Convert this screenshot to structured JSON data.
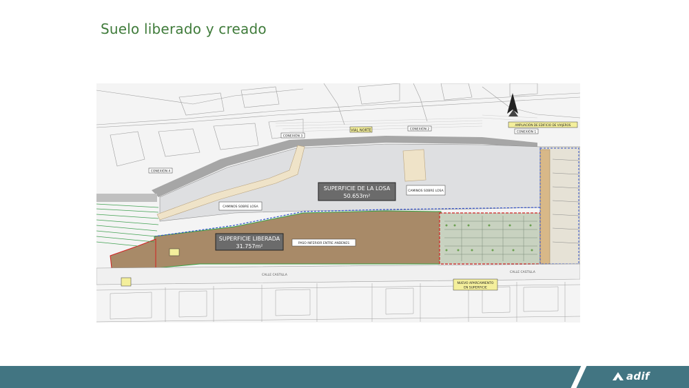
{
  "slide": {
    "title": "Suelo liberado y creado"
  },
  "plan": {
    "labels": {
      "superficie_losa": "SUPERFICIE DE LA LOSA",
      "superficie_losa_value": "50.653m²",
      "superficie_liberada": "SUPERFICIE LIBERADA",
      "superficie_liberada_value": "31.757m²",
      "vial_norte": "VIAL NORTE",
      "conexion_1": "CONEXIÓN 1",
      "conexion_2": "CONEXIÓN 2",
      "conexion_3": "CONEXIÓN 3",
      "conexion_4": "CONEXIÓN 4",
      "ampliacion": "AMPLIACIÓN DE EDIFICIO DE VIAJEROS",
      "caminos_losa_derecha": "CAMINOS SOBRE LOSA",
      "caminos_losa_izquierda": "CAMINOS SOBRE LOSA",
      "paso_inferior": "PASO INFERIOR ENTRE ANDENES",
      "nuevo_aparcamiento_1": "NUEVO APARCAMIENTO",
      "nuevo_aparcamiento_2": "EN SUPERFICIE",
      "calle_castilla_1": "CALLE CASTILLA",
      "calle_castilla_2": "CALLE CASTILLA"
    },
    "colors": {
      "losa": "#dedfe1",
      "liberada": "#a88a68",
      "parking_border": "#d22020",
      "boundary_blue": "#3050c8",
      "green_line": "#36a040",
      "label_yellow": "#f4ef9c"
    }
  },
  "footer": {
    "logo_text": "adif",
    "colors": {
      "band": "#427582"
    }
  }
}
